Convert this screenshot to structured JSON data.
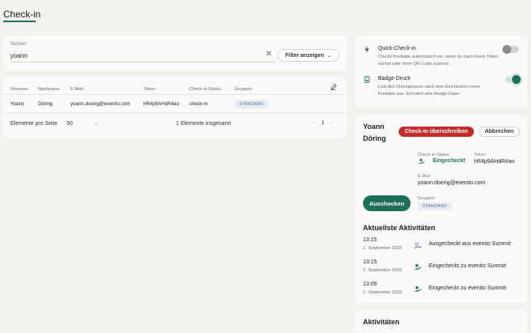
{
  "tabs": {
    "active": "Check-in"
  },
  "search": {
    "label": "Suchen",
    "value": "yoann",
    "filter_label": "Filter anzeigen"
  },
  "table": {
    "columns": [
      "Vorname",
      "Nachname",
      "E-Mail",
      "Token",
      "Check-in-Status",
      "Gruppen"
    ],
    "rows": [
      {
        "first": "Yoann",
        "last": "Döring",
        "email": "yoann.doerig@evenito.com",
        "token": "hR4p9AHdR4ao",
        "status": "check-in",
        "group": "STANDARD"
      }
    ],
    "page_size_label": "Elemente pro Seite",
    "page_size": "50",
    "total": "1 Elemente insgesamt",
    "page": "1"
  },
  "settings": {
    "quick": {
      "title": "Quick-Check-in",
      "desc": "Checkt Kontakte automatisch ein, wenn du nach ihrem Token suchst oder ihren QR-Code scannst.",
      "enabled": false
    },
    "badge": {
      "title": "Badge-Druck",
      "desc": "Löst den Druckprozess nach dem Einchecken eines Kontakts aus. Erfordert eine Badge-Datei.",
      "enabled": true
    }
  },
  "detail": {
    "first_name": "Yoann",
    "last_name": "Döring",
    "override_label": "Check-in überschreiben",
    "cancel_label": "Abbrechen",
    "status_label": "Check-in-Status",
    "status_value": "Eingecheckt",
    "token_label": "Token",
    "token_value": "hR4p9AHdR4ao",
    "email_label": "E-Mail",
    "email_value": "yoann.doerig@evenito.com",
    "checkout_label": "Auschecken",
    "groups_label": "Gruppen",
    "group_value": "STANDARD",
    "recent_title": "Aktuellste Aktivitäten",
    "activities": [
      {
        "time": "13:15",
        "date": "1. September 2026",
        "text": "Ausgecheckt aus evenito Summit",
        "type": "checkout"
      },
      {
        "time": "13:15",
        "date": "1. September 2026",
        "text": "Eingecheckt zu evenito Summit",
        "type": "checkin"
      },
      {
        "time": "13:09",
        "date": "1. September 2026",
        "text": "Eingecheckt zu evenito Summit",
        "type": "checkin"
      }
    ]
  },
  "activities_section": {
    "title": "Aktivitäten"
  },
  "colors": {
    "accent": "#1f6e57",
    "danger": "#c42b2b",
    "success": "#1d7a4a",
    "badge_bg": "#e7ecf4",
    "badge_text": "#5d6f9a"
  }
}
